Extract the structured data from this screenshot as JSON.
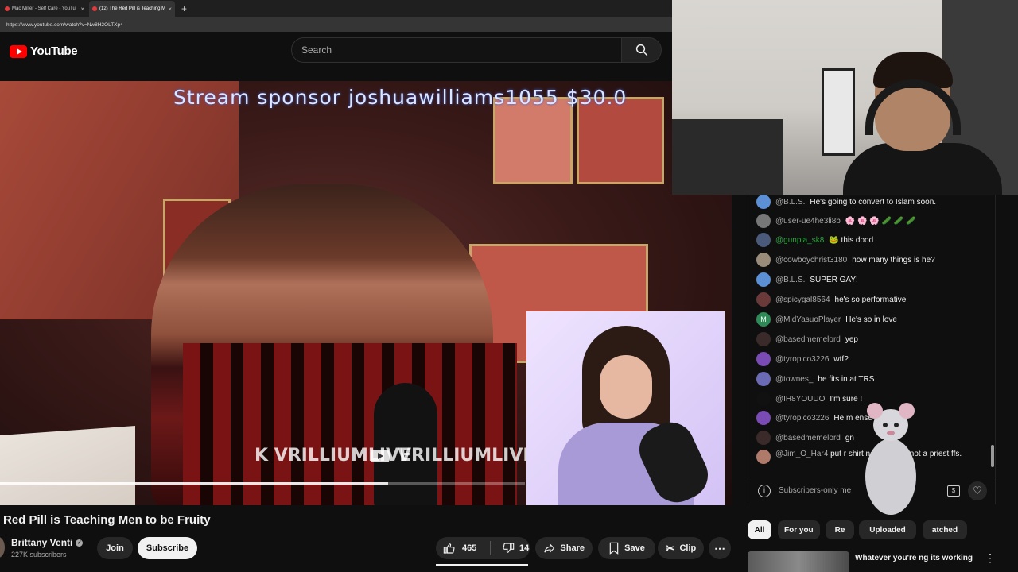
{
  "browser": {
    "tabs": [
      {
        "label": "Mac Miller - Self Care - YouTu",
        "active": false
      },
      {
        "label": "(12) The Red Pill is Teaching M",
        "active": true
      }
    ],
    "url": "https://www.youtube.com/watch?v=Nw8H2OLTXp4"
  },
  "header": {
    "logo_text": "YouTube",
    "search_placeholder": "Search"
  },
  "video": {
    "overlay_sponsor": "Stream sponsor joshuawilliams1055 $30.0",
    "watermark_left": "VRILLIUMLIVE",
    "watermark_right": "VRILLIUMLIVE",
    "progress_fraction": 0.74,
    "title": "Red Pill is Teaching Men to be Fruity"
  },
  "channel": {
    "name": "Brittany Venti",
    "subscribers": "227K subscribers",
    "join_label": "Join",
    "subscribe_label": "Subscribe"
  },
  "actions": {
    "likes": "465",
    "dislikes": "14",
    "share_label": "Share",
    "save_label": "Save",
    "clip_label": "Clip"
  },
  "chat": {
    "messages": [
      {
        "user": "@B.L.S.",
        "text": "He's going to convert to Islam soon.",
        "avatar_color": "#5b8fd6",
        "avatar_letter": ""
      },
      {
        "user": "@user-ue4he3li8b",
        "text": "🌸 🌸 🌸 🥒 🥒 🥒",
        "avatar_color": "#777777",
        "avatar_letter": ""
      },
      {
        "user": "@gunpla_sk8",
        "text": "🐸 this dood",
        "avatar_color": "#4a5a7a",
        "avatar_letter": "",
        "green": true
      },
      {
        "user": "@cowboychrist3180",
        "text": "how many things is he?",
        "avatar_color": "#9a8c7a",
        "avatar_letter": ""
      },
      {
        "user": "@B.L.S.",
        "text": "SUPER GAY!",
        "avatar_color": "#5b8fd6",
        "avatar_letter": ""
      },
      {
        "user": "@spicygal8564",
        "text": "he's so performative",
        "avatar_color": "#6a3a3a",
        "avatar_letter": ""
      },
      {
        "user": "@MidYasuoPlayer",
        "text": "He's so in love",
        "avatar_color": "#2e8b57",
        "avatar_letter": "M"
      },
      {
        "user": "@basedmemelord",
        "text": "yep",
        "avatar_color": "#3a2a2a",
        "avatar_letter": ""
      },
      {
        "user": "@tyropico3226",
        "text": "wtf?",
        "avatar_color": "#7a4ab5",
        "avatar_letter": ""
      },
      {
        "user": "@townes_",
        "text": "he fits in at TRS",
        "avatar_color": "#6a6ab5",
        "avatar_letter": ""
      },
      {
        "user": "@IH8YOUUO",
        "text": "I'm sure !",
        "avatar_color": "#111111",
        "avatar_letter": ""
      },
      {
        "user": "@tyropico3226",
        "text": "He m      ense",
        "avatar_color": "#7a4ab5",
        "avatar_letter": ""
      },
      {
        "user": "@basedmemelord",
        "text": "           gn",
        "avatar_color": "#3a2a2a",
        "avatar_letter": ""
      },
      {
        "user": "@Jim_O_Har4",
        "text": "put         r shirt nerd, you're not a priest ffs.",
        "avatar_color": "#b07a6a",
        "avatar_letter": ""
      }
    ],
    "input_placeholder": "Subscribers-only me"
  },
  "chips": [
    "All",
    "For you",
    "Re",
    "Uploaded",
    "atched"
  ],
  "recommendation": {
    "title": "Whatever you're      ng its working"
  },
  "colors": {
    "background": "#0f0f0f",
    "brand_red": "#ff0000",
    "chip_bg": "#272727"
  }
}
